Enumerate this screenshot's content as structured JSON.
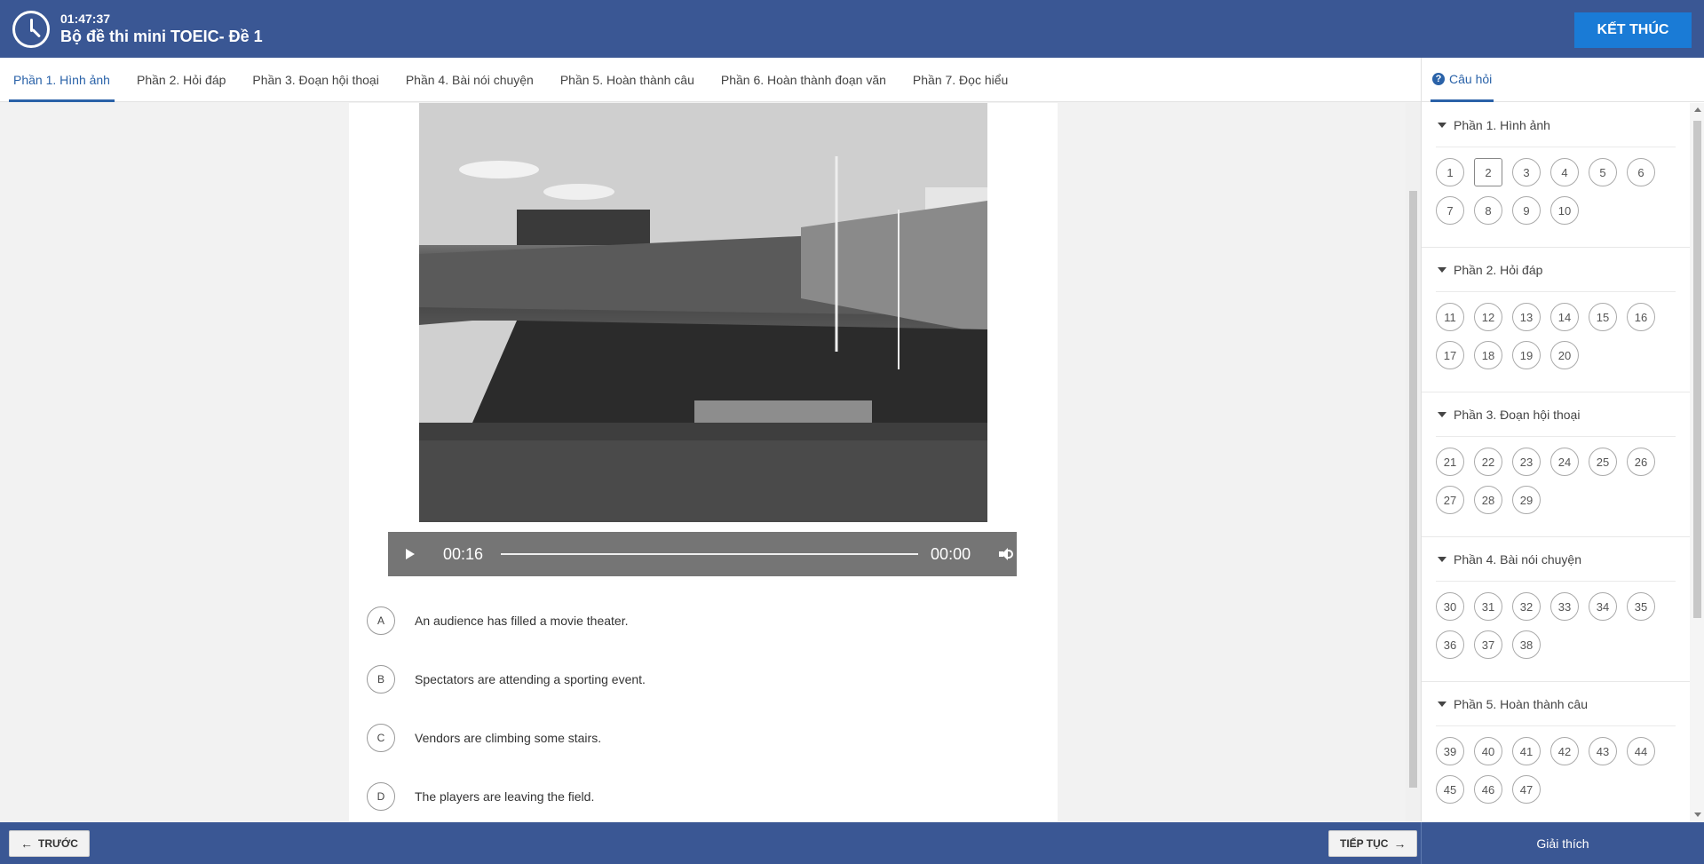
{
  "header": {
    "timer": "01:47:37",
    "title": "Bộ đề thi mini TOEIC- Đề 1",
    "end_button": "KẾT THÚC"
  },
  "tabs": [
    {
      "label": "Phần 1. Hình ảnh",
      "active": true
    },
    {
      "label": "Phần 2. Hỏi đáp"
    },
    {
      "label": "Phần 3. Đoạn hội thoại"
    },
    {
      "label": "Phần 4. Bài nói chuyện"
    },
    {
      "label": "Phần 5. Hoàn thành câu"
    },
    {
      "label": "Phần 6. Hoàn thành đoạn văn"
    },
    {
      "label": "Phần 7. Đọc hiểu"
    }
  ],
  "audio": {
    "current_time": "00:16",
    "total_time": "00:00"
  },
  "options": [
    {
      "letter": "A",
      "text": "An audience has filled a movie theater."
    },
    {
      "letter": "B",
      "text": "Spectators are attending a sporting event."
    },
    {
      "letter": "C",
      "text": "Vendors are climbing some stairs."
    },
    {
      "letter": "D",
      "text": "The players are leaving the field."
    }
  ],
  "panel": {
    "tab_label": "Câu hỏi",
    "current_question": "2",
    "sections": [
      {
        "title": "Phần 1. Hình ảnh",
        "questions": [
          "1",
          "2",
          "3",
          "4",
          "5",
          "6",
          "7",
          "8",
          "9",
          "10"
        ]
      },
      {
        "title": "Phần 2. Hỏi đáp",
        "questions": [
          "11",
          "12",
          "13",
          "14",
          "15",
          "16",
          "17",
          "18",
          "19",
          "20"
        ]
      },
      {
        "title": "Phần 3. Đoạn hội thoại",
        "questions": [
          "21",
          "22",
          "23",
          "24",
          "25",
          "26",
          "27",
          "28",
          "29"
        ]
      },
      {
        "title": "Phần 4. Bài nói chuyện",
        "questions": [
          "30",
          "31",
          "32",
          "33",
          "34",
          "35",
          "36",
          "37",
          "38"
        ]
      },
      {
        "title": "Phần 5. Hoàn thành câu",
        "questions": [
          "39",
          "40",
          "41",
          "42",
          "43",
          "44",
          "45",
          "46",
          "47"
        ]
      }
    ]
  },
  "footer": {
    "prev_label": "TRƯỚC",
    "next_label": "TIẾP TỤC",
    "explain_label": "Giải thích"
  },
  "colors": {
    "header_bg": "#3a5794",
    "accent": "#2a62a8",
    "end_button": "#1a7bd6"
  }
}
